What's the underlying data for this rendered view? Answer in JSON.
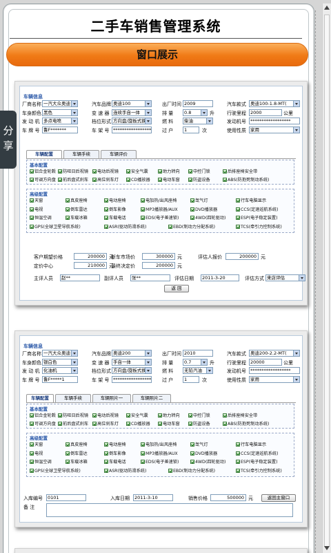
{
  "page": {
    "title": "二手车销售管理系统",
    "banner": "窗口展示",
    "share": [
      "分",
      "享"
    ]
  },
  "colors": {
    "banner": "#f07a16",
    "section_title": "#2a58a8",
    "share_tab": "#333c42"
  },
  "icons": {
    "dropdown": "chevron-down-icon",
    "checkbox": "checked-box-icon",
    "scroll_up": "arrow-up-icon",
    "scroll_down": "arrow-down-icon"
  },
  "shot1": {
    "section": "车辆信息",
    "fields": {
      "maker_label": "厂商名称",
      "maker": "一汽大众奥迪",
      "brand_label": "汽车品牌",
      "brand": "奥迪100",
      "year_label": "出厂时间",
      "year": "2009",
      "model_label": "汽车款式",
      "model": "奥迪100-1.8-MT(",
      "color_label": "车身颜色",
      "color": "黑色",
      "gearbox_label": "变 速 器",
      "gearbox": "连续手自一体",
      "disp_label": "排    量",
      "disp": "0.8",
      "disp_unit": "升",
      "mileage_label": "行驶里程",
      "mileage": "2000",
      "mileage_unit": "公里",
      "engine_label": "发 动 机",
      "engine": "多点电喷",
      "steer_label": "档位形式",
      "steer": "方向盘/旋板式换",
      "fuel_label": "燃    料",
      "fuel": "柴油",
      "engno_label": "发动机号",
      "engno": "******************",
      "plate_label": "车 牌 号",
      "plate": "鲁F*******",
      "frame_label": "车 架 号",
      "frame": "*******************",
      "owners_label": "过    户",
      "owners": "1",
      "owners_unit": "次",
      "use_label": "使用性质",
      "use": "家用"
    },
    "tabs": [
      "车辆配置",
      "车辆手续",
      "车辆评价"
    ],
    "basic_title": "基本配置",
    "basic": [
      [
        "铝合金轮毂",
        "防旺日后视镜",
        "电动后视镜",
        "安全气囊",
        "助力转向",
        "中控门锁",
        "后排座椅安全带"
      ],
      [
        "可调方向盘",
        "前后盘式刹车",
        "高位刹车灯",
        "CD播放器",
        "电动车窗",
        "防盗设备",
        "ABS(防抱死制动系统)"
      ]
    ],
    "adv_title": "高级配置",
    "adv": [
      [
        "天窗",
        "真皮座椅",
        "电动座椅",
        "电加热/出风座椅",
        "氙气灯",
        "行车电脑显示"
      ],
      [
        "电视",
        "倒车雷达",
        "倒车影像",
        "MP3播放器/AUX",
        "DVD播放器",
        "CCS(定速巡航系统)"
      ],
      [
        "恒温空调",
        "车载冰箱",
        "车载电话",
        "EDS(电子差速锁)",
        "4WD(四轮驱动)",
        "ESP(电子稳定装置)"
      ],
      [
        "GPS(全球卫星导航系统)",
        "ASR(驱动防滑系统)",
        "EBD(制动力分配系统)",
        "TCS(牵引力控制系统)"
      ]
    ],
    "prices": {
      "expect_label": "客户期望价格",
      "expect": "200000",
      "expect_unit": "元",
      "newprice_label": "新车市场价",
      "newprice": "300000",
      "newprice_unit": "元",
      "eval_label": "评估人报价",
      "eval": "200000",
      "eval_unit": "元",
      "center_label": "定价中心",
      "center": "210000",
      "center_unit": "元",
      "final_label": "最终决定价",
      "final": "200000",
      "final_unit": "元"
    },
    "people": {
      "main_label": "主评人员",
      "main": "赵**",
      "sub_label": "副评人员",
      "sub": "张**",
      "date_label": "评估日期",
      "date": "2011-3-20",
      "method_label": "评估方式",
      "method": "来店评估"
    },
    "back": "返    回"
  },
  "shot2": {
    "section": "车辆信息",
    "fields": {
      "maker_label": "厂商名称",
      "maker": "一汽大众奥迪",
      "brand_label": "汽车品牌",
      "brand": "奥迪200",
      "year_label": "出厂时间",
      "year": "2010",
      "model_label": "汽车款式",
      "model": "奥迪200-2.2-MT(",
      "color_label": "车身颜色",
      "color": "银白色",
      "gearbox_label": "变 速 器",
      "gearbox": "手自一体",
      "disp_label": "排    量",
      "disp": "0.7",
      "disp_unit": "升",
      "mileage_label": "行驶里程",
      "mileage": "20000",
      "mileage_unit": "公里",
      "engine_label": "发 动 机",
      "engine": "化油机",
      "steer_label": "档位形式",
      "steer": "方向盘/旋板式换",
      "fuel_label": "燃    料",
      "fuel": "无铅汽油",
      "engno_label": "发动机号",
      "engno": "******************",
      "plate_label": "车 牌 号",
      "plate": "鲁F*****1",
      "frame_label": "车 架 号",
      "frame": "*******************",
      "owners_label": "过    户",
      "owners": "1",
      "owners_unit": "次",
      "use_label": "使用性质",
      "use": "家用"
    },
    "tabs": [
      "车辆配置",
      "车辆手续",
      "车辆照片一",
      "车辆照片二"
    ],
    "basic_title": "基本配置",
    "basic": [
      [
        "铝合金轮毂",
        "防旺日后视镜",
        "电动后视镜",
        "安全气囊",
        "助力转向",
        "中控门锁",
        "后排座椅安全带"
      ],
      [
        "可调方向盘",
        "前后盘式刹车",
        "高位刹车灯",
        "CD播放器",
        "电动车窗",
        "防盗设备",
        "ABS(防抱死制动系统)"
      ]
    ],
    "adv_title": "高级配置",
    "adv": [
      [
        "天窗",
        "真皮座椅",
        "电动座椅",
        "电加热/出风座椅",
        "氙气灯",
        "行车电脑显示"
      ],
      [
        "电视",
        "倒车雷达",
        "倒车影像",
        "MP3播放器/AUX",
        "DVD播放器",
        "CCS(定速巡航系统)"
      ],
      [
        "恒温空调",
        "车载冰箱",
        "车载电话",
        "EDS(电子差速锁)",
        "4WD(四轮驱动)",
        "ESP(电子稳定装置)"
      ],
      [
        "GPS(全球卫星导航系统)",
        "ASR(驱动防滑系统)",
        "EBD(制动力分配系统)",
        "TCS(牵引力控制系统)"
      ]
    ],
    "stock": {
      "no_label": "入库编号",
      "no": "0101",
      "date_label": "入库日期",
      "date": "2011-3-10",
      "price_label": "销售价格",
      "price": "500000",
      "price_unit": "元",
      "note_label": "备    注"
    },
    "back": "返回主窗口"
  }
}
